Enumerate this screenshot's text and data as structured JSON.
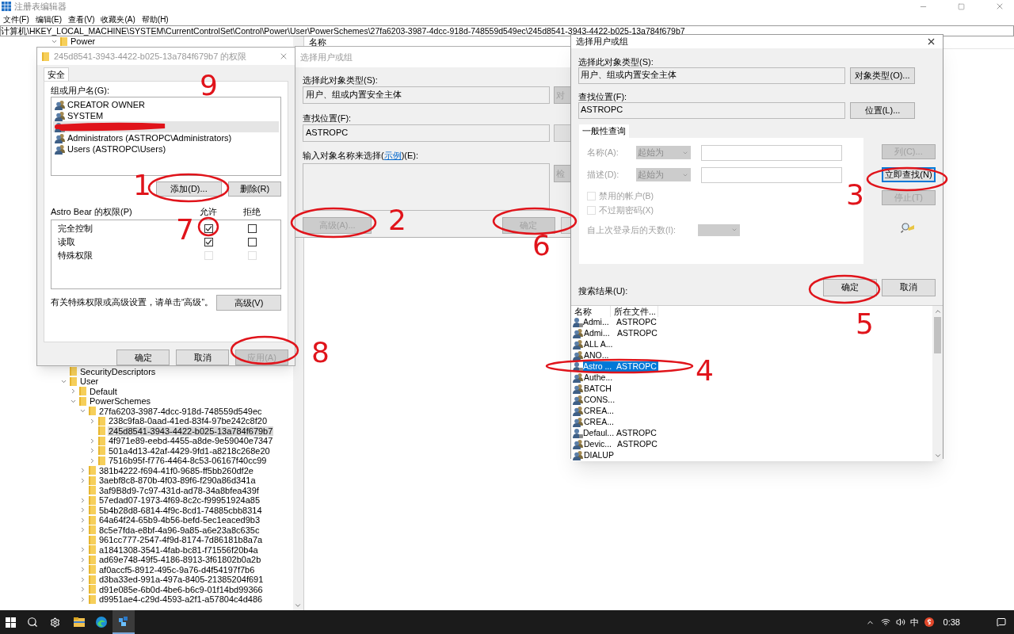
{
  "registry": {
    "title": "注册表编辑器",
    "menu": [
      "文件(F)",
      "编辑(E)",
      "查看(V)",
      "收藏夹(A)",
      "帮助(H)"
    ],
    "address": "计算机\\HKEY_LOCAL_MACHINE\\SYSTEM\\CurrentControlSet\\Control\\Power\\User\\PowerSchemes\\27fa6203-3987-4dcc-918d-748559d549ec\\245d8541-3943-4422-b025-13a784f679b7",
    "list_header": "名称",
    "tree": [
      {
        "label": "Power",
        "expandable": true,
        "expanded": true,
        "selected": false,
        "children": [
          {
            "label": "SecurityDescriptors",
            "expandable": false,
            "selected": false
          },
          {
            "label": "User",
            "expandable": true,
            "expanded": true,
            "selected": false,
            "children": [
              {
                "label": "Default",
                "expandable": true,
                "expanded": false,
                "selected": false
              },
              {
                "label": "PowerSchemes",
                "expandable": true,
                "expanded": true,
                "selected": false,
                "children": [
                  {
                    "label": "27fa6203-3987-4dcc-918d-748559d549ec",
                    "expandable": true,
                    "expanded": true,
                    "selected": false,
                    "children": [
                      {
                        "label": "238c9fa8-0aad-41ed-83f4-97be242c8f20",
                        "expandable": true,
                        "expanded": false,
                        "selected": false
                      },
                      {
                        "label": "245d8541-3943-4422-b025-13a784f679b7",
                        "expandable": false,
                        "selected": true
                      },
                      {
                        "label": "4f971e89-eebd-4455-a8de-9e59040e7347",
                        "expandable": true,
                        "expanded": false,
                        "selected": false
                      },
                      {
                        "label": "501a4d13-42af-4429-9fd1-a8218c268e20",
                        "expandable": true,
                        "expanded": false,
                        "selected": false
                      },
                      {
                        "label": "7516b95f-f776-4464-8c53-06167f40cc99",
                        "expandable": true,
                        "expanded": false,
                        "selected": false
                      }
                    ]
                  },
                  {
                    "label": "381b4222-f694-41f0-9685-ff5bb260df2e",
                    "expandable": true,
                    "expanded": false,
                    "selected": false
                  },
                  {
                    "label": "3aebf8c8-870b-4f03-89f6-f290a86d341a",
                    "expandable": true,
                    "expanded": false,
                    "selected": false
                  },
                  {
                    "label": "3af9B8d9-7c97-431d-ad78-34a8bfea439f",
                    "expandable": false,
                    "selected": false
                  },
                  {
                    "label": "57edad07-1973-4f69-8c2c-f99951924a85",
                    "expandable": true,
                    "expanded": false,
                    "selected": false
                  },
                  {
                    "label": "5b4b28d8-6814-4f9c-8cd1-74885cbb8314",
                    "expandable": true,
                    "expanded": false,
                    "selected": false
                  },
                  {
                    "label": "64a64f24-65b9-4b56-befd-5ec1eaced9b3",
                    "expandable": true,
                    "expanded": false,
                    "selected": false
                  },
                  {
                    "label": "8c5e7fda-e8bf-4a96-9a85-a6e23a8c635c",
                    "expandable": true,
                    "expanded": false,
                    "selected": false
                  },
                  {
                    "label": "961cc777-2547-4f9d-8174-7d86181b8a7a",
                    "expandable": false,
                    "selected": false
                  },
                  {
                    "label": "a1841308-3541-4fab-bc81-f71556f20b4a",
                    "expandable": true,
                    "expanded": false,
                    "selected": false
                  },
                  {
                    "label": "ad69e748-49f5-4186-8913-3f61802b0a2b",
                    "expandable": true,
                    "expanded": false,
                    "selected": false
                  },
                  {
                    "label": "af0accf5-8912-495c-9a76-d4f54197f7b6",
                    "expandable": true,
                    "expanded": false,
                    "selected": false
                  },
                  {
                    "label": "d3ba33ed-991a-497a-8405-21385204f691",
                    "expandable": true,
                    "expanded": false,
                    "selected": false
                  },
                  {
                    "label": "d91e085e-6b0d-4be6-b6c9-01f14bd99366",
                    "expandable": true,
                    "expanded": false,
                    "selected": false
                  },
                  {
                    "label": "d9951ae4-c29d-4593-a2f1-a57804c4d486",
                    "expandable": true,
                    "expanded": false,
                    "selected": false
                  }
                ]
              }
            ]
          }
        ]
      }
    ]
  },
  "permissions_dialog": {
    "title": "245d8541-3943-4422-b025-13a784f679b7 的权限",
    "tab": {
      "label": "安全",
      "selected": true
    },
    "group_label": "组或用户名(G):",
    "principals": [
      {
        "kind": "group",
        "name": "CREATOR OWNER",
        "selected": false
      },
      {
        "kind": "group",
        "name": "SYSTEM",
        "selected": false
      },
      {
        "kind": "redacted",
        "selected": true
      },
      {
        "kind": "group",
        "name": "Administrators (ASTROPC\\Administrators)",
        "selected": false
      },
      {
        "kind": "group",
        "name": "Users (ASTROPC\\Users)",
        "selected": false
      }
    ],
    "add_button": "添加(D)...",
    "remove_button": "删除(R)",
    "permissions_label": "Astro Bear 的权限(P)",
    "allow_header": "允许",
    "deny_header": "拒绝",
    "permissions": [
      {
        "name": "完全控制",
        "allow": true,
        "deny": false,
        "disabled": false
      },
      {
        "name": "读取",
        "allow": true,
        "deny": false,
        "disabled": false
      },
      {
        "name": "特殊权限",
        "allow": false,
        "deny": false,
        "disabled": true
      }
    ],
    "advanced_hint": "有关特殊权限或高级设置，请单击“高级”。",
    "advanced_button": "高级(V)",
    "buttons": [
      {
        "label": "确定",
        "disabled": false
      },
      {
        "label": "取消",
        "disabled": false
      },
      {
        "label": "应用(A)",
        "disabled": true
      }
    ]
  },
  "select_dialog_back": {
    "title": "选择用户或组",
    "object_type_label": "选择此对象类型(S):",
    "object_type": "用户、组或内置安全主体",
    "object_type_button": "对",
    "location_label": "查找位置(F):",
    "location": "ASTROPC",
    "names_label_before": "输入对象名称来选择(",
    "names_link": "示例",
    "names_label_after": ")(E):",
    "check_button": "检",
    "advanced_button": {
      "label": "高级(A)...",
      "disabled": true
    },
    "ok_button": {
      "label": "确定",
      "disabled": true
    }
  },
  "select_dialog": {
    "title": "选择用户或组",
    "object_type_label": "选择此对象类型(S):",
    "object_type": "用户、组或内置安全主体",
    "object_type_button": "对象类型(O)...",
    "location_label": "查找位置(F):",
    "location": "ASTROPC",
    "location_button": "位置(L)...",
    "query_tab": {
      "label": "一般性查询",
      "selected": true
    },
    "query_rows": [
      {
        "label": "名称(A):",
        "mode": "起始为",
        "disabled": true
      },
      {
        "label": "描述(D):",
        "mode": "起始为",
        "disabled": true
      }
    ],
    "query_checks": [
      {
        "label": "禁用的帐户(B)",
        "checked": false,
        "disabled": true
      },
      {
        "label": "不过期密码(X)",
        "checked": false,
        "disabled": true
      }
    ],
    "days_label": "自上次登录后的天数(I):",
    "side_buttons": [
      {
        "label": "列(C)...",
        "disabled": true,
        "focused": false
      },
      {
        "label": "立即查找(N)",
        "disabled": false,
        "focused": true
      },
      {
        "label": "停止(T)",
        "disabled": true,
        "focused": false
      }
    ],
    "ok_button": "确定",
    "cancel_button": "取消",
    "results_label": "搜索结果(U):",
    "columns": [
      "名称",
      "所在文件..."
    ],
    "results": [
      {
        "kind": "user",
        "name": "Admi...",
        "folder": "ASTROPC",
        "selected": false
      },
      {
        "kind": "group",
        "name": "Admi...",
        "folder": "ASTROPC",
        "selected": false
      },
      {
        "kind": "group",
        "name": "ALL A...",
        "selected": false
      },
      {
        "kind": "group",
        "name": "ANO...",
        "selected": false
      },
      {
        "kind": "user",
        "name": "Astro ...",
        "folder": "ASTROPC",
        "selected": true
      },
      {
        "kind": "group",
        "name": "Authe...",
        "selected": false
      },
      {
        "kind": "group",
        "name": "BATCH",
        "selected": false
      },
      {
        "kind": "group",
        "name": "CONS...",
        "selected": false
      },
      {
        "kind": "group",
        "name": "CREA...",
        "selected": false
      },
      {
        "kind": "group",
        "name": "CREA...",
        "selected": false
      },
      {
        "kind": "user",
        "name": "Defaul...",
        "folder": "ASTROPC",
        "selected": false
      },
      {
        "kind": "group",
        "name": "Devic...",
        "folder": "ASTROPC",
        "selected": false
      },
      {
        "kind": "group",
        "name": "DIALUP",
        "selected": false
      }
    ]
  },
  "taskbar": {
    "apps": [
      {
        "kind": "folder",
        "active": false
      },
      {
        "kind": "browser",
        "active": false
      },
      {
        "kind": "registry",
        "active": true
      }
    ],
    "ime": "中",
    "clock": "0:38"
  },
  "annotations": [
    {
      "label": "1"
    },
    {
      "label": "2"
    },
    {
      "label": "3"
    },
    {
      "label": "4"
    },
    {
      "label": "5"
    },
    {
      "label": "6"
    },
    {
      "label": "7"
    },
    {
      "label": "8"
    },
    {
      "label": "9"
    }
  ]
}
